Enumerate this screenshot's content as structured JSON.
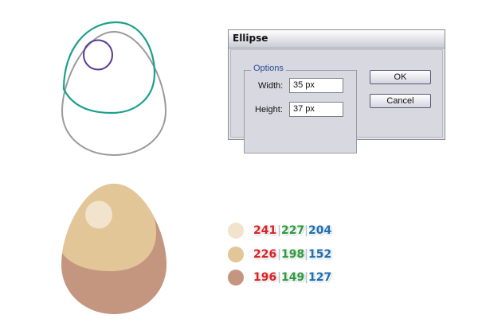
{
  "dialog": {
    "title": "Ellipse",
    "options_label": "Options",
    "width_label": "Width:",
    "width_value": "35 px",
    "height_label": "Height:",
    "height_value": "37 px",
    "ok_label": "OK",
    "cancel_label": "Cancel"
  },
  "colors": {
    "egg_outline": "#9a9a9a",
    "cap_outline": "#1aa08c",
    "spot_outline": "#5a3a96",
    "highlight": "#f1e3cc",
    "cap": "#e2c698",
    "base": "#c4957f"
  },
  "swatches": [
    {
      "color": "#f1e3cc",
      "r": "241",
      "g": "227",
      "b": "204"
    },
    {
      "color": "#e2c698",
      "r": "226",
      "g": "198",
      "b": "152"
    },
    {
      "color": "#c4957f",
      "r": "196",
      "g": "149",
      "b": "127"
    }
  ]
}
